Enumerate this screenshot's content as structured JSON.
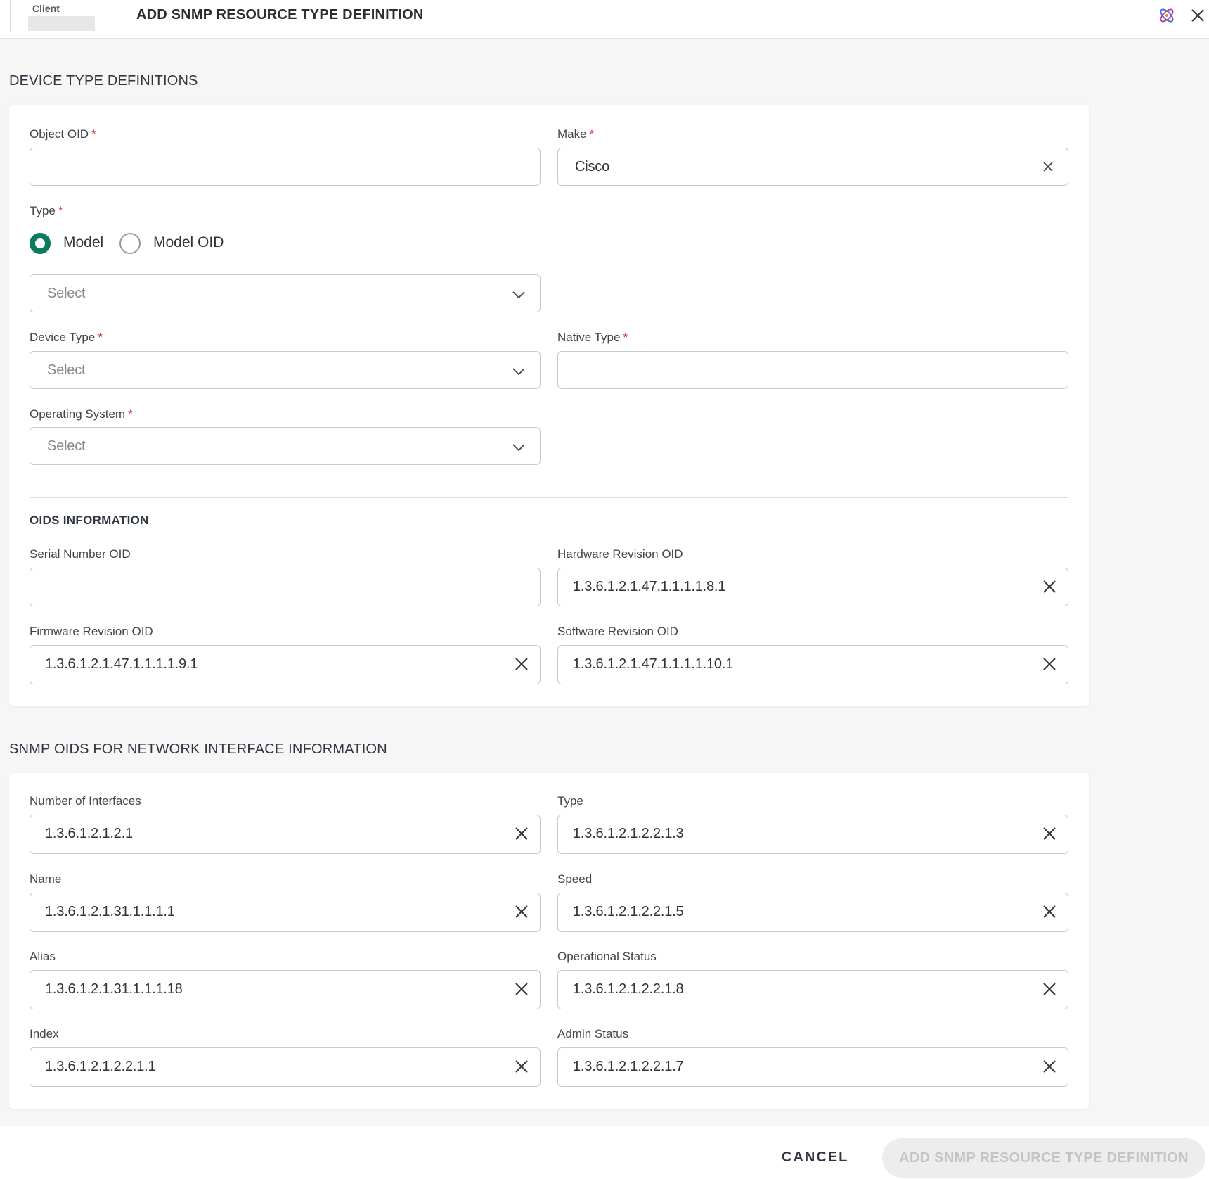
{
  "header": {
    "client_label": "Client",
    "title": "ADD SNMP RESOURCE TYPE DEFINITION"
  },
  "device_section": {
    "heading": "DEVICE TYPE DEFINITIONS",
    "object_oid": {
      "label": "Object OID",
      "value": ""
    },
    "make": {
      "label": "Make",
      "value": "Cisco"
    },
    "type": {
      "label": "Type",
      "options": [
        "Model",
        "Model OID"
      ],
      "selected": "Model",
      "select_placeholder": "Select"
    },
    "device_type": {
      "label": "Device Type",
      "placeholder": "Select"
    },
    "native_type": {
      "label": "Native Type",
      "value": ""
    },
    "operating_system": {
      "label": "Operating System",
      "placeholder": "Select"
    },
    "required_marker": "*"
  },
  "oids_info": {
    "heading": "OIDS INFORMATION",
    "serial_number_oid": {
      "label": "Serial Number OID",
      "value": ""
    },
    "hardware_revision_oid": {
      "label": "Hardware Revision OID",
      "value": "1.3.6.1.2.1.47.1.1.1.1.8.1"
    },
    "firmware_revision_oid": {
      "label": "Firmware Revision OID",
      "value": "1.3.6.1.2.1.47.1.1.1.1.9.1"
    },
    "software_revision_oid": {
      "label": "Software Revision OID",
      "value": "1.3.6.1.2.1.47.1.1.1.1.10.1"
    }
  },
  "network_section": {
    "heading": "SNMP OIDS FOR NETWORK INTERFACE INFORMATION",
    "number_of_interfaces": {
      "label": "Number of Interfaces",
      "value": "1.3.6.1.2.1.2.1"
    },
    "type": {
      "label": "Type",
      "value": "1.3.6.1.2.1.2.2.1.3"
    },
    "name": {
      "label": "Name",
      "value": "1.3.6.1.2.1.31.1.1.1.1"
    },
    "speed": {
      "label": "Speed",
      "value": "1.3.6.1.2.1.2.2.1.5"
    },
    "alias": {
      "label": "Alias",
      "value": "1.3.6.1.2.1.31.1.1.1.18"
    },
    "operational_status": {
      "label": "Operational Status",
      "value": "1.3.6.1.2.1.2.2.1.8"
    },
    "index": {
      "label": "Index",
      "value": "1.3.6.1.2.1.2.2.1.1"
    },
    "admin_status": {
      "label": "Admin Status",
      "value": "1.3.6.1.2.1.2.2.1.7"
    }
  },
  "footer": {
    "cancel_label": "CANCEL",
    "submit_label": "ADD SNMP RESOURCE TYPE DEFINITION"
  },
  "colors": {
    "accent": "#0c7a5e",
    "required": "#d32f2f",
    "disabled_button_bg": "#ededed"
  },
  "icons": {
    "top_right_logo": "app-logo-icon",
    "close": "close-icon",
    "clear": "clear-icon",
    "dropdown": "chevron-down-icon"
  }
}
